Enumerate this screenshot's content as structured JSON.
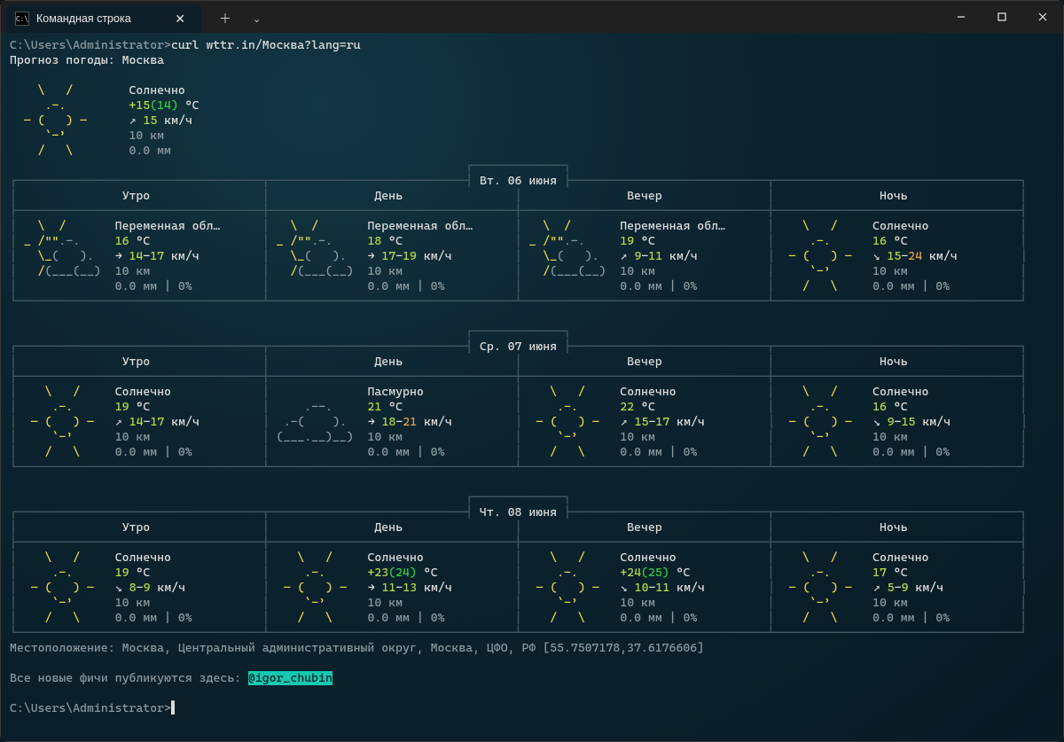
{
  "window": {
    "tab_title": "Командная строка"
  },
  "prompt1_path": "C:\\Users\\Administrator>",
  "command": "curl wttr.in/Москва?lang=ru",
  "header": "Прогноз погоды: Москва",
  "current": {
    "cond": "Солнечно",
    "temp_main": "+15",
    "temp_paren": "(14)",
    "temp_unit": " °C",
    "wind_arrow": "↗ ",
    "wind_val": "15",
    "wind_unit": " км/ч",
    "vis": "10 км",
    "precip": "0.0 мм"
  },
  "part_labels": {
    "morn": "Утро",
    "noon": "День",
    "eve": "Вечер",
    "night": "Ночь"
  },
  "days": [
    {
      "date": "Вт. 06 июня",
      "parts": [
        {
          "icon": "partly",
          "cond": "Переменная обл…",
          "temp": "16",
          "temp_unit": " °C",
          "wind_pre": "→ ",
          "wind_a": "14",
          "wind_dash": "-",
          "wind_b": "17",
          "wind_unit": " км/ч",
          "vis": "10 км",
          "precip": "0.0 мм | 0%"
        },
        {
          "icon": "partly",
          "cond": "Переменная обл…",
          "temp": "18",
          "temp_unit": " °C",
          "wind_pre": "→ ",
          "wind_a": "17",
          "wind_dash": "-",
          "wind_b": "19",
          "wind_unit": " км/ч",
          "vis": "10 км",
          "precip": "0.0 мм | 0%"
        },
        {
          "icon": "partly",
          "cond": "Переменная обл…",
          "temp": "19",
          "temp_unit": " °C",
          "wind_pre": "↗ ",
          "wind_a": "9",
          "wind_dash": "-",
          "wind_b": "11",
          "wind_unit": " км/ч",
          "vis": "10 км",
          "precip": "0.0 мм | 0%"
        },
        {
          "icon": "sun",
          "cond": "Солнечно",
          "temp": "16",
          "temp_unit": " °C",
          "wind_pre": "↘ ",
          "wind_a": "15",
          "wind_dash": "-",
          "wind_b": "24",
          "wind_unit": " км/ч",
          "vis": "10 км",
          "precip": "0.0 мм | 0%"
        }
      ]
    },
    {
      "date": "Ср. 07 июня",
      "parts": [
        {
          "icon": "sun",
          "cond": "Солнечно",
          "temp": "19",
          "temp_unit": " °C",
          "wind_pre": "↗ ",
          "wind_a": "14",
          "wind_dash": "-",
          "wind_b": "17",
          "wind_unit": " км/ч",
          "vis": "10 км",
          "precip": "0.0 мм | 0%"
        },
        {
          "icon": "cloud",
          "cond": "Пасмурно",
          "temp": "21",
          "temp_unit": " °C",
          "wind_pre": "→ ",
          "wind_a": "18",
          "wind_dash": "-",
          "wind_b": "21",
          "wind_unit": " км/ч",
          "vis": "10 км",
          "precip": "0.0 мм | 0%"
        },
        {
          "icon": "sun",
          "cond": "Солнечно",
          "temp": "22",
          "temp_unit": " °C",
          "wind_pre": "↗ ",
          "wind_a": "15",
          "wind_dash": "-",
          "wind_b": "17",
          "wind_unit": " км/ч",
          "vis": "10 км",
          "precip": "0.0 мм | 0%"
        },
        {
          "icon": "sun",
          "cond": "Солнечно",
          "temp": "16",
          "temp_unit": " °C",
          "wind_pre": "↘ ",
          "wind_a": "9",
          "wind_dash": "-",
          "wind_b": "15",
          "wind_unit": " км/ч",
          "vis": "10 км",
          "precip": "0.0 мм | 0%"
        }
      ]
    },
    {
      "date": "Чт. 08 июня",
      "parts": [
        {
          "icon": "sun",
          "cond": "Солнечно",
          "temp": "19",
          "temp_unit": " °C",
          "wind_pre": "↘ ",
          "wind_a": "8",
          "wind_dash": "-",
          "wind_b": "9",
          "wind_unit": " км/ч",
          "vis": "10 км",
          "precip": "0.0 мм | 0%"
        },
        {
          "icon": "sun",
          "cond": "Солнечно",
          "temp": "+23",
          "temp_paren": "(24)",
          "temp_unit": " °C",
          "wind_pre": "→ ",
          "wind_a": "11",
          "wind_dash": "-",
          "wind_b": "13",
          "wind_unit": " км/ч",
          "vis": "10 км",
          "precip": "0.0 мм | 0%"
        },
        {
          "icon": "sun",
          "cond": "Солнечно",
          "temp": "+24",
          "temp_paren": "(25)",
          "temp_unit": " °C",
          "wind_pre": "↘ ",
          "wind_a": "10",
          "wind_dash": "-",
          "wind_b": "11",
          "wind_unit": " км/ч",
          "vis": "10 км",
          "precip": "0.0 мм | 0%"
        },
        {
          "icon": "sun",
          "cond": "Солнечно",
          "temp": "17",
          "temp_unit": " °C",
          "wind_pre": "↗ ",
          "wind_a": "5",
          "wind_dash": "-",
          "wind_b": "9",
          "wind_unit": " км/ч",
          "vis": "10 км",
          "precip": "0.0 мм | 0%"
        }
      ]
    }
  ],
  "location_line": "Местоположение: Москва, Центральный административный округ, Москва, ЦФО, РФ [55.7507178,37.6176606]",
  "footer_pre": "Все новые фичи публикуются здесь: ",
  "footer_handle": "@igor_chubin",
  "prompt2_path": "C:\\Users\\Administrator>"
}
